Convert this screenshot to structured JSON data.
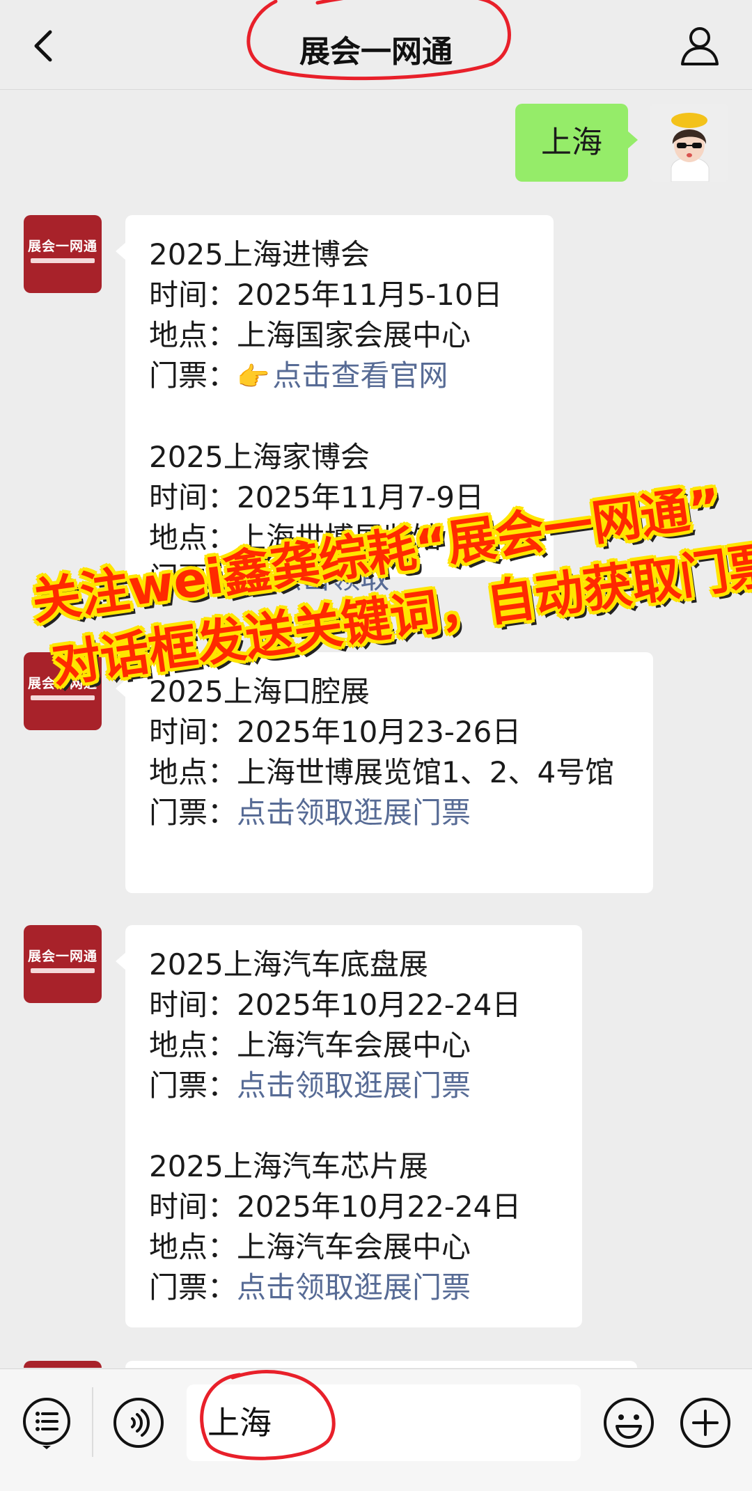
{
  "header": {
    "title": "展会一网通"
  },
  "logo_text": "展会一网通",
  "user_message": "上海",
  "messages": [
    {
      "events": [
        {
          "name": "2025上海进博会",
          "time_label": "时间：",
          "time": "2025年11月5-10日",
          "place_label": "地点：",
          "place": "上海国家会展中心",
          "ticket_label": "门票：",
          "ticket": "点击查看官网"
        },
        {
          "name": "2025上海家博会",
          "time_label": "时间：",
          "time": "2025年11月7-9日",
          "place_label": "地点：",
          "place": "上海世博展览馆",
          "ticket_label": "门票：",
          "ticket": "点击领取"
        }
      ]
    },
    {
      "events": [
        {
          "name": "2025上海口腔展",
          "time_label": "时间：",
          "time": "2025年10月23-26日",
          "place_label": "地点：",
          "place": "上海世博展览馆1、2、4号馆",
          "ticket_label": "门票：",
          "ticket": "点击领取逛展门票"
        }
      ]
    },
    {
      "events": [
        {
          "name": "2025上海汽车底盘展",
          "time_label": "时间：",
          "time": "2025年10月22-24日",
          "place_label": "地点：",
          "place": "上海汽车会展中心",
          "ticket_label": "门票：",
          "ticket": "点击领取逛展门票"
        },
        {
          "name": "2025上海汽车芯片展",
          "time_label": "时间：",
          "time": "2025年10月22-24日",
          "place_label": "地点：",
          "place": "上海汽车会展中心",
          "ticket_label": "门票：",
          "ticket": "点击领取逛展门票"
        }
      ]
    }
  ],
  "overlay": {
    "line1": "关注wei鑫龚综耗“展会一网通”",
    "line2": "对话框发送关键词，自动获取门票"
  },
  "input": {
    "value": "上海"
  },
  "colors": {
    "bubble_me": "#95ec69",
    "link": "#576b95",
    "logo_bg": "#a8222a",
    "annotation_red": "#e8202a",
    "banner_text": "#ff2a00",
    "banner_outline": "#ffe500"
  }
}
